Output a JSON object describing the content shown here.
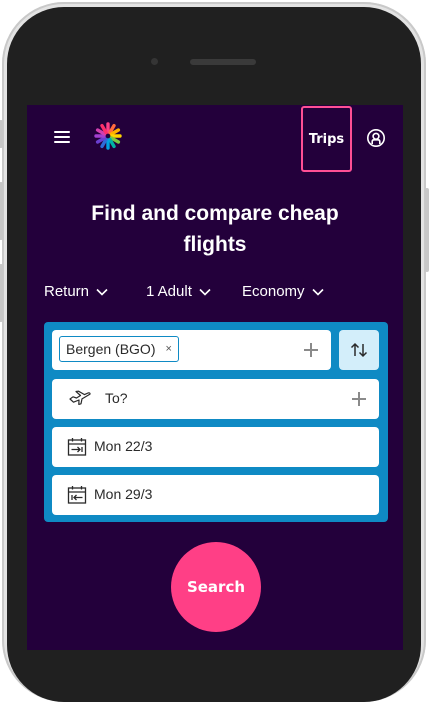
{
  "nav": {
    "menu_icon": "hamburger-icon",
    "logo_icon": "brand-logo",
    "trips_label": "Trips",
    "account_icon": "account-icon"
  },
  "hero": {
    "title_line1": "Find and compare cheap",
    "title_line2": "flights"
  },
  "filters": {
    "trip_type": "Return",
    "travelers": "1 Adult",
    "cabin_class": "Economy"
  },
  "search_form": {
    "origin_chip": "Bergen (BGO)",
    "origin_remove": "×",
    "destination_placeholder": "To?",
    "depart_date": "Mon 22/3",
    "return_date": "Mon 29/3"
  },
  "search_button": "Search",
  "colors": {
    "screen_bg": "#23003b",
    "form_bg": "#0f8ac4",
    "accent_pink": "#ff3f86",
    "trips_outline": "#ff4f95",
    "swap_bg": "#d3eefa"
  }
}
